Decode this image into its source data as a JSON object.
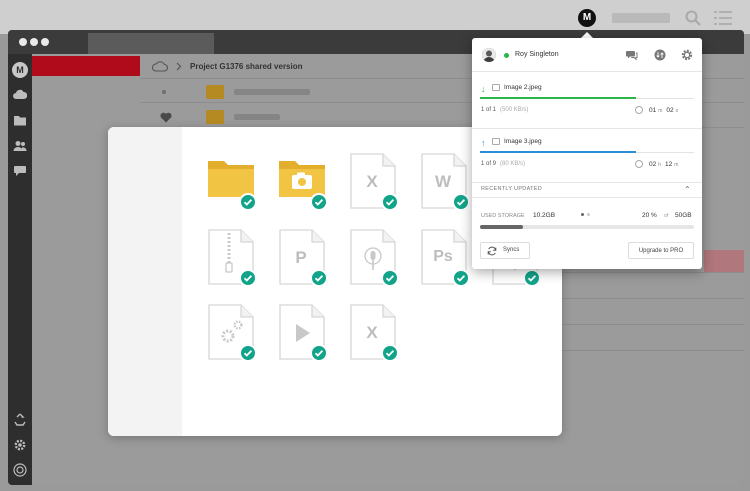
{
  "menubar": {
    "app_logo": "M",
    "icons": [
      "mega-logo-icon",
      "search-icon",
      "list-icon"
    ]
  },
  "sidebar": {
    "logo": "M",
    "icons": [
      "mega-logo-icon",
      "cloud-icon",
      "folder-icon",
      "contacts-icon",
      "chat-icon",
      "rubbish-bin-icon",
      "gear-icon",
      "transfers-icon"
    ]
  },
  "filebrowser": {
    "breadcrumb": {
      "root_icon": "cloud-icon",
      "separator_icon": "chevron-right-icon",
      "current": "Project G1376 shared version"
    }
  },
  "file_grid": {
    "items": [
      {
        "type": "folder",
        "icon": "folder-icon",
        "letter": ""
      },
      {
        "type": "camera-folder",
        "icon": "camera-folder-icon",
        "letter": ""
      },
      {
        "type": "excel",
        "icon": "excel-file-icon",
        "letter": "X"
      },
      {
        "type": "word",
        "icon": "word-file-icon",
        "letter": "W"
      },
      {
        "type": "vector",
        "icon": "vector-file-icon",
        "letter": ""
      },
      {
        "type": "archive",
        "icon": "zip-file-icon",
        "letter": ""
      },
      {
        "type": "powerpoint",
        "icon": "powerpoint-file-icon",
        "letter": "P"
      },
      {
        "type": "audio",
        "icon": "audio-file-icon",
        "letter": ""
      },
      {
        "type": "photoshop",
        "icon": "photoshop-file-icon",
        "letter": "Ps"
      },
      {
        "type": "audio",
        "icon": "audio-file-icon",
        "letter": ""
      },
      {
        "type": "settings",
        "icon": "executable-file-icon",
        "letter": ""
      },
      {
        "type": "video",
        "icon": "video-file-icon",
        "letter": ""
      },
      {
        "type": "excel",
        "icon": "excel-file-icon",
        "letter": "X"
      }
    ],
    "check_color": "#12a48a"
  },
  "panel": {
    "user_name": "Roy Singleton",
    "status": "online",
    "header_icons": [
      "chat-icon",
      "transfer-manager-icon",
      "gear-icon"
    ],
    "transfers": [
      {
        "direction": "download",
        "arrow": "↓",
        "arrow_color": "#2ab54b",
        "file_name": "Image 2.jpeg",
        "count": "1 of 1",
        "speed": "(500 KB/s)",
        "progress": 0.73,
        "eta_a": "01",
        "eta_a_unit": "m",
        "eta_b": "02",
        "eta_b_unit": "s"
      },
      {
        "direction": "upload",
        "arrow": "↑",
        "arrow_color": "#2a8fd6",
        "file_name": "Image 3.jpeg",
        "count": "1 of 9",
        "speed": "(80 KB/s)",
        "progress": 0.73,
        "eta_a": "02",
        "eta_a_unit": "h",
        "eta_b": "12",
        "eta_b_unit": "m"
      }
    ],
    "recently_updated_label": "RECENTLY UPDATED",
    "storage": {
      "label": "USED STORAGE",
      "used": "10.2GB",
      "percent_text": "20 %",
      "of": "of",
      "total": "50GB",
      "fraction": 0.2
    },
    "syncs_label": "Syncs",
    "upgrade_label": "Upgrade to PRO"
  }
}
